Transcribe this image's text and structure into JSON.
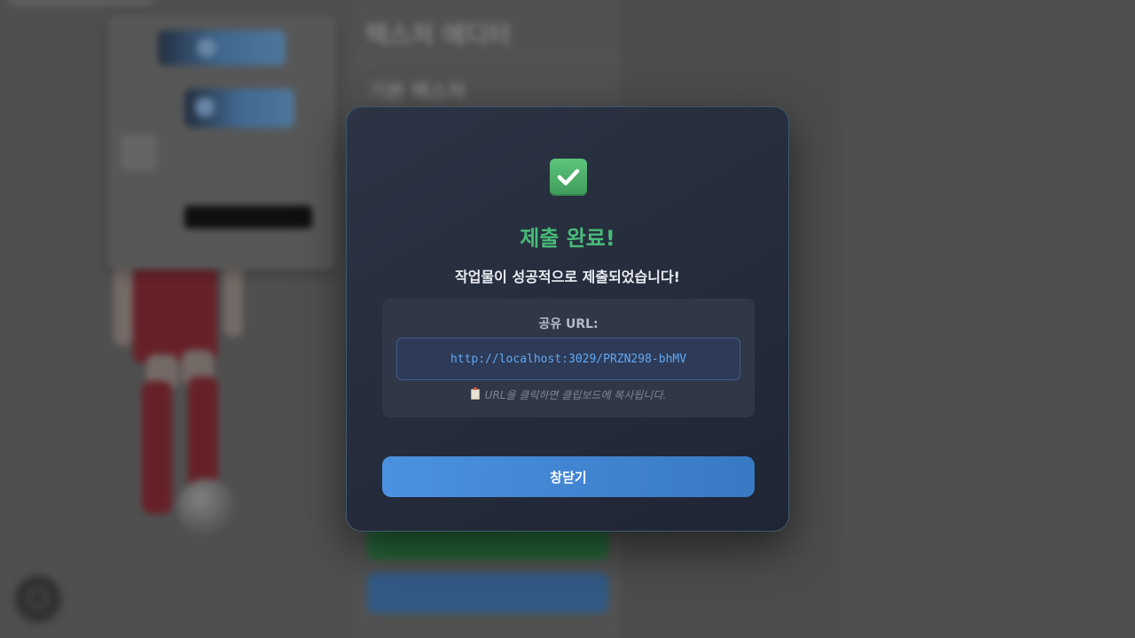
{
  "modal": {
    "icon": "check-mark-icon",
    "title": "제출 완료!",
    "message": "작업물이 성공적으로 제출되었습니다!",
    "url_label": "공유 URL:",
    "url_value": "http://localhost:3029/PRZN298-bhMV",
    "url_hint": "URL을 클릭하면 클립보드에 복사됩니다.",
    "hint_icon": "clipboard-icon",
    "close_label": "창닫기"
  },
  "background": {
    "heading": "텍스처 에디터",
    "subheading": "기본 텍스처"
  },
  "colors": {
    "success": "#48bb78",
    "url_text": "#63a8f2",
    "button": "#4a92e0",
    "modal_bg": "#2c3445"
  }
}
